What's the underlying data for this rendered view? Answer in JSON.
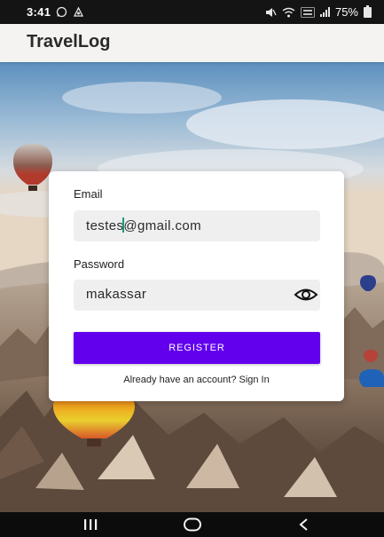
{
  "status_bar": {
    "time": "3:41",
    "battery": "75%"
  },
  "app_bar": {
    "title": "TravelLog"
  },
  "form": {
    "email_label": "Email",
    "email_value_before_cursor": "testes",
    "email_value_after_cursor": "@gmail.com",
    "password_label": "Password",
    "password_value": "makassar",
    "register_label": "REGISTER",
    "signin_text": "Already have an account? Sign In"
  },
  "colors": {
    "primary": "#6200ee",
    "card": "#ffffff",
    "field_bg": "#efefef",
    "cursor": "#1a9a7a"
  },
  "icons": {
    "status_left": [
      "whatsapp-icon",
      "notification-icon"
    ],
    "status_right": [
      "mute-icon",
      "wifi-icon",
      "lte-icon",
      "signal-icon",
      "battery-icon"
    ],
    "password_toggle": "eye-icon",
    "nav": [
      "recents-icon",
      "home-icon",
      "back-icon"
    ]
  }
}
